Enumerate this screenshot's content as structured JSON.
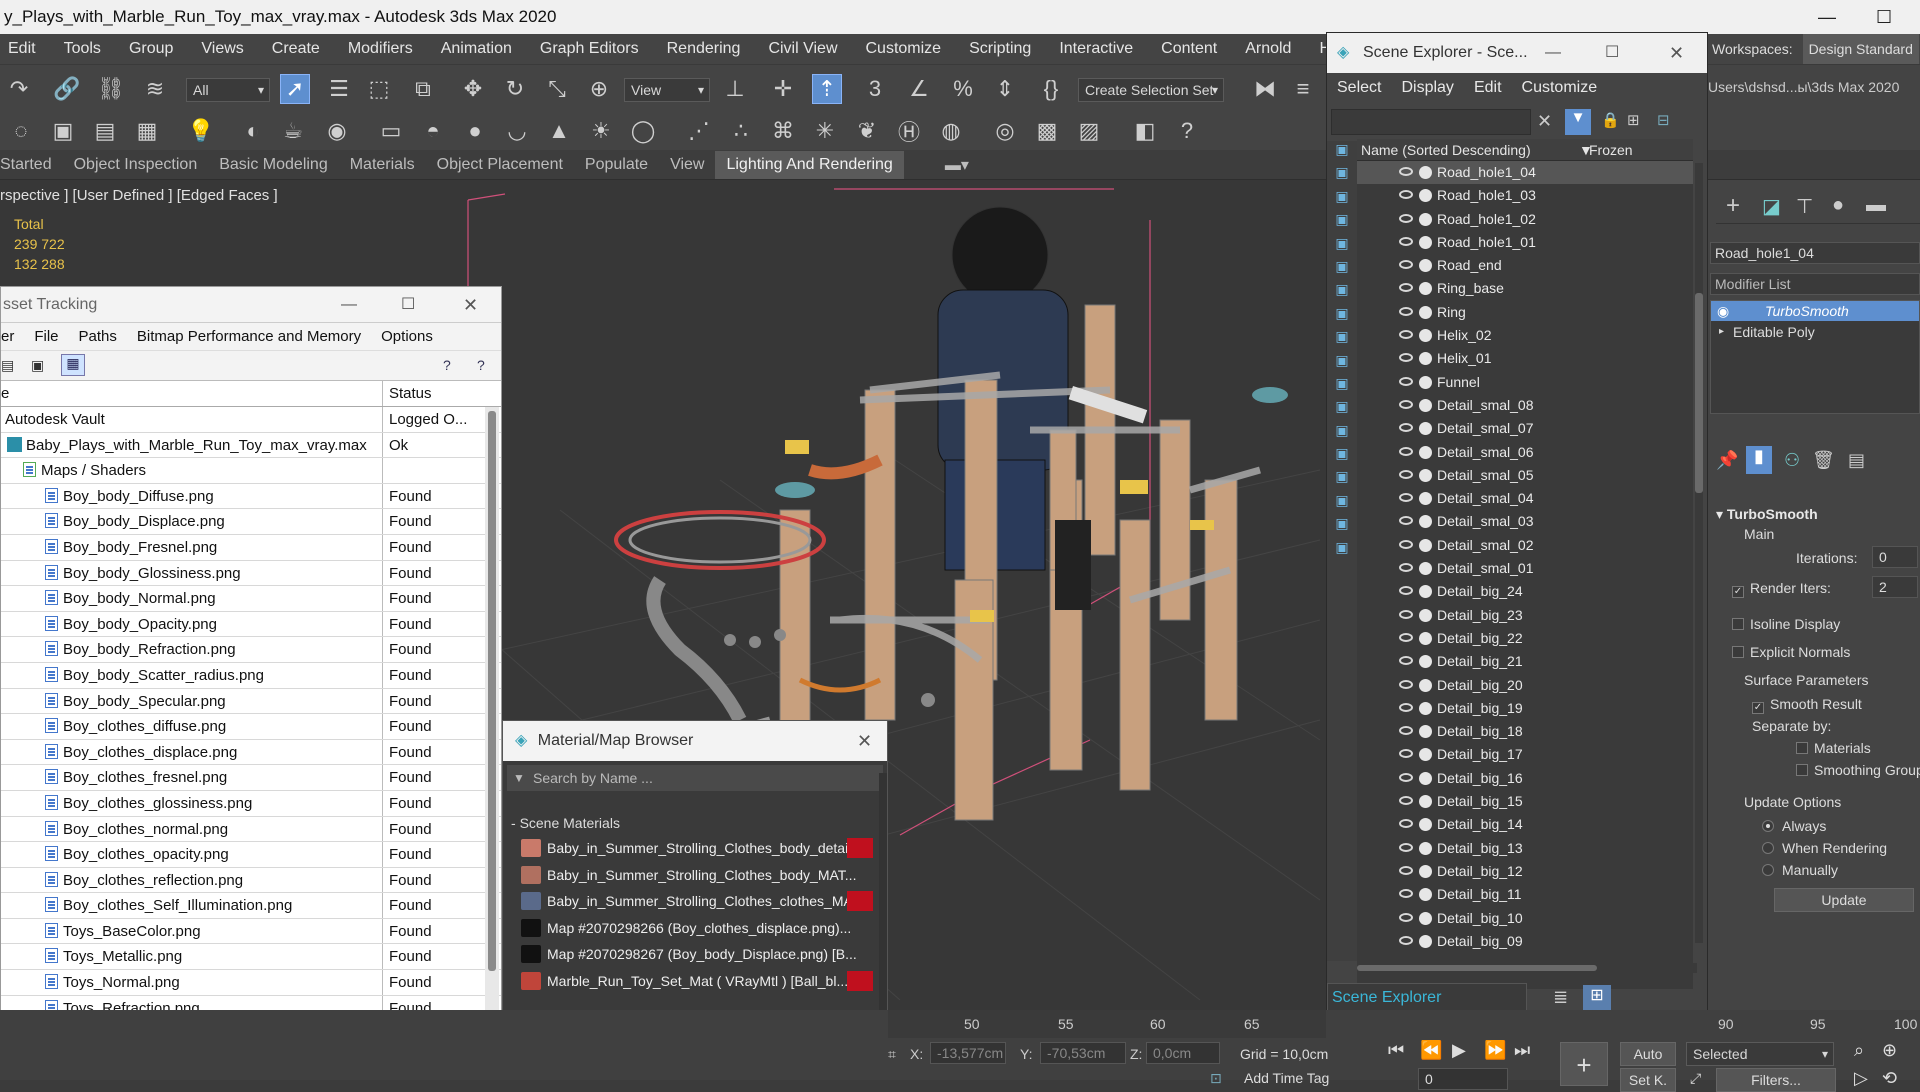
{
  "titlebar": {
    "title": "y_Plays_with_Marble_Run_Toy_max_vray.max - Autodesk 3ds Max 2020",
    "min": "—",
    "max": "☐"
  },
  "menubar": [
    "Edit",
    "Tools",
    "Group",
    "Views",
    "Create",
    "Modifiers",
    "Animation",
    "Graph Editors",
    "Rendering",
    "Civil View",
    "Customize",
    "Scripting",
    "Interactive",
    "Content",
    "Arnold",
    "Help"
  ],
  "workspaces": {
    "label": "Workspaces:",
    "value": "Design Standard",
    "path": "Users\\dshsd...ы\\3ds Max 2020"
  },
  "toolbar": {
    "filter": "All",
    "view": "View",
    "selection_set": "Create Selection Set"
  },
  "ribbon": [
    "Started",
    "Object Inspection",
    "Basic Modeling",
    "Materials",
    "Object Placement",
    "Populate",
    "View",
    "Lighting And Rendering"
  ],
  "viewport": {
    "label": "rspective ] [User Defined ] [Edged Faces ]",
    "stats_label": "Total",
    "polys": "239 722",
    "verts": "132 288"
  },
  "asset_tracking": {
    "title": "sset Tracking",
    "menu": [
      "er",
      "File",
      "Paths",
      "Bitmap Performance and Memory",
      "Options"
    ],
    "col_name": "e",
    "col_status": "Status",
    "rows": [
      {
        "name": "Autodesk Vault",
        "status": "Logged O...",
        "indent": 0,
        "icon": "none"
      },
      {
        "name": "Baby_Plays_with_Marble_Run_Toy_max_vray.max",
        "status": "Ok",
        "indent": 1,
        "icon": "max"
      },
      {
        "name": "Maps / Shaders",
        "status": "",
        "indent": 2,
        "icon": "folder"
      },
      {
        "name": "Boy_body_Diffuse.png",
        "status": "Found",
        "indent": 3,
        "icon": "file"
      },
      {
        "name": "Boy_body_Displace.png",
        "status": "Found",
        "indent": 3,
        "icon": "file"
      },
      {
        "name": "Boy_body_Fresnel.png",
        "status": "Found",
        "indent": 3,
        "icon": "file"
      },
      {
        "name": "Boy_body_Glossiness.png",
        "status": "Found",
        "indent": 3,
        "icon": "file"
      },
      {
        "name": "Boy_body_Normal.png",
        "status": "Found",
        "indent": 3,
        "icon": "file"
      },
      {
        "name": "Boy_body_Opacity.png",
        "status": "Found",
        "indent": 3,
        "icon": "file"
      },
      {
        "name": "Boy_body_Refraction.png",
        "status": "Found",
        "indent": 3,
        "icon": "file"
      },
      {
        "name": "Boy_body_Scatter_radius.png",
        "status": "Found",
        "indent": 3,
        "icon": "file"
      },
      {
        "name": "Boy_body_Specular.png",
        "status": "Found",
        "indent": 3,
        "icon": "file"
      },
      {
        "name": "Boy_clothes_diffuse.png",
        "status": "Found",
        "indent": 3,
        "icon": "file"
      },
      {
        "name": "Boy_clothes_displace.png",
        "status": "Found",
        "indent": 3,
        "icon": "file"
      },
      {
        "name": "Boy_clothes_fresnel.png",
        "status": "Found",
        "indent": 3,
        "icon": "file"
      },
      {
        "name": "Boy_clothes_glossiness.png",
        "status": "Found",
        "indent": 3,
        "icon": "file"
      },
      {
        "name": "Boy_clothes_normal.png",
        "status": "Found",
        "indent": 3,
        "icon": "file"
      },
      {
        "name": "Boy_clothes_opacity.png",
        "status": "Found",
        "indent": 3,
        "icon": "file"
      },
      {
        "name": "Boy_clothes_reflection.png",
        "status": "Found",
        "indent": 3,
        "icon": "file"
      },
      {
        "name": "Boy_clothes_Self_Illumination.png",
        "status": "Found",
        "indent": 3,
        "icon": "file"
      },
      {
        "name": "Toys_BaseColor.png",
        "status": "Found",
        "indent": 3,
        "icon": "file"
      },
      {
        "name": "Toys_Metallic.png",
        "status": "Found",
        "indent": 3,
        "icon": "file"
      },
      {
        "name": "Toys_Normal.png",
        "status": "Found",
        "indent": 3,
        "icon": "file"
      },
      {
        "name": "Toys_Refraction.png",
        "status": "Found",
        "indent": 3,
        "icon": "file"
      }
    ]
  },
  "material_browser": {
    "title": "Material/Map Browser",
    "search": "Search by Name ...",
    "section": "Scene Materials",
    "items": [
      {
        "label": "Baby_in_Summer_Strolling_Clothes_body_detail...",
        "swatch": "#c97a6a",
        "red": true
      },
      {
        "label": "Baby_in_Summer_Strolling_Clothes_body_MAT...",
        "swatch": "#b07060",
        "red": false
      },
      {
        "label": "Baby_in_Summer_Strolling_Clothes_clothes_MA...",
        "swatch": "#5a6a8a",
        "red": true
      },
      {
        "label": "Map #2070298266 (Boy_clothes_displace.png)...",
        "swatch": "#111111",
        "red": false
      },
      {
        "label": "Map #2070298267 (Boy_body_Displace.png)  [B...",
        "swatch": "#111111",
        "red": false
      },
      {
        "label": "Marble_Run_Toy_Set_Mat  ( VRayMtl )  [Ball_bl...",
        "swatch": "#c0453a",
        "red": true
      }
    ]
  },
  "scene_explorer": {
    "title": "Scene Explorer - Sce...",
    "menu": [
      "Select",
      "Display",
      "Edit",
      "Customize"
    ],
    "col_name": "Name (Sorted Descending)",
    "col_frozen": "Frozen",
    "items": [
      "Road_hole1_04",
      "Road_hole1_03",
      "Road_hole1_02",
      "Road_hole1_01",
      "Road_end",
      "Ring_base",
      "Ring",
      "Helix_02",
      "Helix_01",
      "Funnel",
      "Detail_smal_08",
      "Detail_smal_07",
      "Detail_smal_06",
      "Detail_smal_05",
      "Detail_smal_04",
      "Detail_smal_03",
      "Detail_smal_02",
      "Detail_smal_01",
      "Detail_big_24",
      "Detail_big_23",
      "Detail_big_22",
      "Detail_big_21",
      "Detail_big_20",
      "Detail_big_19",
      "Detail_big_18",
      "Detail_big_17",
      "Detail_big_16",
      "Detail_big_15",
      "Detail_big_14",
      "Detail_big_13",
      "Detail_big_12",
      "Detail_big_11",
      "Detail_big_10",
      "Detail_big_09"
    ],
    "footer": "Scene Explorer"
  },
  "command_panel": {
    "object_name": "Road_hole1_04",
    "modifier_list": "Modifier List",
    "stack": [
      "TurboSmooth",
      "Editable Poly"
    ],
    "rollout": "TurboSmooth",
    "main": "Main",
    "iterations_label": "Iterations:",
    "iterations": "0",
    "render_iters_label": "Render Iters:",
    "render_iters": "2",
    "isoline": "Isoline Display",
    "explicit": "Explicit Normals",
    "surface": "Surface Parameters",
    "smooth": "Smooth Result",
    "separate": "Separate by:",
    "materials": "Materials",
    "smoothing": "Smoothing Groups",
    "update_options": "Update Options",
    "always": "Always",
    "when_rendering": "When Rendering",
    "manually": "Manually",
    "update": "Update"
  },
  "timeline": {
    "ticks": [
      "50",
      "55",
      "60",
      "65",
      "90",
      "95",
      "100"
    ]
  },
  "status": {
    "x_label": "X:",
    "x": "-13,577cm",
    "y_label": "Y:",
    "y": "-70,53cm",
    "z_label": "Z:",
    "z": "0,0cm",
    "grid": "Grid = 10,0cm",
    "add_time_tag": "Add Time Tag",
    "auto": "Auto",
    "selected": "Selected",
    "setk": "Set K.",
    "filters": "Filters...",
    "frame": "0"
  }
}
